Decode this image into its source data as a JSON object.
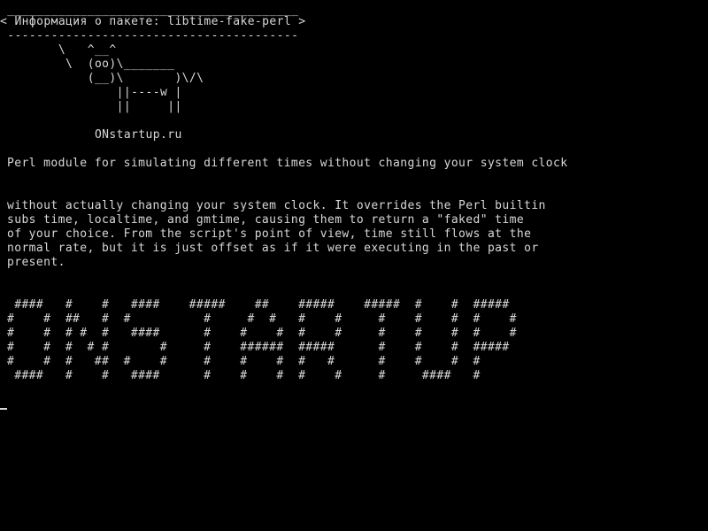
{
  "terminal": {
    "cowsay": {
      "border_top": " ________________________________________",
      "title": "< Информация о пакете: libtime-fake-perl >",
      "border_bottom": " ----------------------------------------",
      "cow_lines": [
        "        \\   ^__^",
        "         \\  (oo)\\_______",
        "            (__)\\       )\\/\\",
        "                ||----w |",
        "                ||     ||"
      ]
    },
    "site": "             ONstartup.ru",
    "summary": "Perl module for simulating different times without changing your system clock",
    "description_lines": [
      "without actually changing your system clock. It overrides the Perl builtin",
      "subs time, localtime, and gmtime, causing them to return a \"faked\" time",
      "of your choice. From the script's point of view, time still flows at the",
      "normal rate, but it is just offset as if it were executing in the past or",
      "present."
    ],
    "banner_lines": [
      " ####   #    #   ####    #####    ##    #####    #####  #    #  #####",
      "#    #  ##   #  #          #     #  #   #    #     #    #    #  #    #",
      "#    #  # #  #   ####      #    #    #  #    #     #    #    #  #    #",
      "#    #  #  # #       #     #    ######  #####      #    #    #  #####",
      "#    #  #   ##  #    #     #    #    #  #   #      #    #    #  #",
      " ####   #    #   ####      #    #    #  #    #     #     ####   #"
    ]
  }
}
